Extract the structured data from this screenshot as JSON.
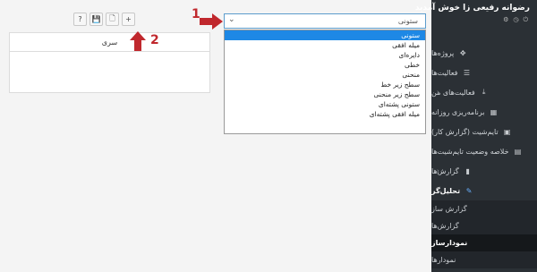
{
  "sidebar": {
    "greeting": "رضوانه رفیعی زا خوش آمدید",
    "header_icons": [
      "power-icon",
      "clock-icon",
      "gear-icon"
    ],
    "items": [
      {
        "label": "پروژه‌ها",
        "icon": "puzzle-icon"
      },
      {
        "label": "فعالیت‌ها",
        "icon": "list-icon"
      },
      {
        "label": "فعالیت‌های من",
        "icon": "download-icon"
      },
      {
        "label": "برنامه‌ریزی روزانه",
        "icon": "calendar-icon"
      },
      {
        "label": "تایم‌شیت (گزارش کار)",
        "icon": "timesheet-icon"
      },
      {
        "label": "خلاصه وضعیت تایم‌شیت‌ها",
        "icon": "table-icon"
      },
      {
        "label": "گزارش‌ها",
        "icon": "file-icon"
      },
      {
        "label": "تحلیل‌گر",
        "icon": "pencil-icon"
      }
    ],
    "subitems": [
      {
        "label": "گزارش ساز"
      },
      {
        "label": "گزارش‌ها"
      },
      {
        "label": "نمودارساز"
      },
      {
        "label": "نمودارها"
      }
    ]
  },
  "toolbar": {
    "help_label": "?",
    "save_label": "💾",
    "file_label": "🗋",
    "add_label": "+"
  },
  "table": {
    "header": "سری"
  },
  "select": {
    "value": "ستونی",
    "chevron": "⌄",
    "options": [
      "ستونی",
      "میله افقی",
      "دایره‌ای",
      "خطی",
      "منحنی",
      "سطح زیر خط",
      "سطح زیر منحنی",
      "ستونی پشته‌ای",
      "میله افقی پشته‌ای"
    ]
  },
  "annotations": {
    "marker1": "1",
    "marker2": "2",
    "color": "#c0282d"
  }
}
